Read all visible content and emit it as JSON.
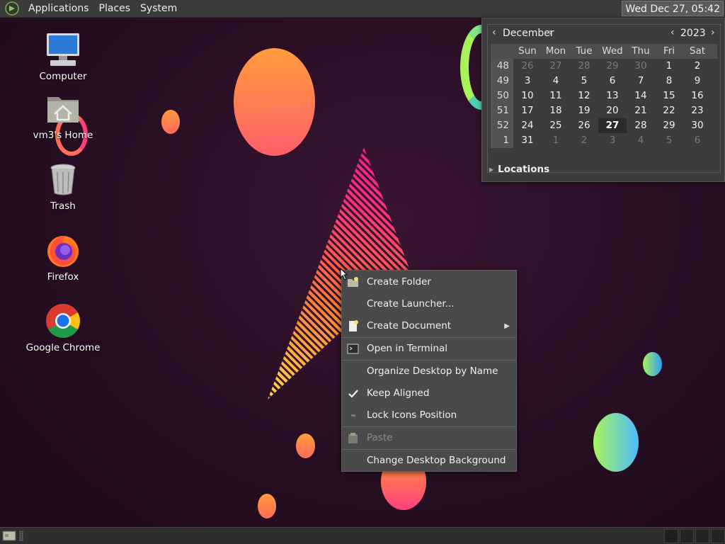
{
  "top_panel": {
    "menus": [
      "Applications",
      "Places",
      "System"
    ],
    "clock": "Wed Dec 27, 05:42"
  },
  "desktop_icons": [
    {
      "label": "Computer",
      "icon": "computer-icon"
    },
    {
      "label": "vm3's Home",
      "icon": "home-folder-icon"
    },
    {
      "label": "Trash",
      "icon": "trash-icon"
    },
    {
      "label": "Firefox",
      "icon": "firefox-icon"
    },
    {
      "label": "Google Chrome",
      "icon": "chrome-icon"
    }
  ],
  "calendar": {
    "month": "December",
    "year": "2023",
    "weekday_headers": [
      "Sun",
      "Mon",
      "Tue",
      "Wed",
      "Thu",
      "Fri",
      "Sat"
    ],
    "weeks": [
      {
        "week": "48",
        "days": [
          "26",
          "27",
          "28",
          "29",
          "30",
          "1",
          "2"
        ]
      },
      {
        "week": "49",
        "days": [
          "3",
          "4",
          "5",
          "6",
          "7",
          "8",
          "9"
        ]
      },
      {
        "week": "50",
        "days": [
          "10",
          "11",
          "12",
          "13",
          "14",
          "15",
          "16"
        ]
      },
      {
        "week": "51",
        "days": [
          "17",
          "18",
          "19",
          "20",
          "21",
          "22",
          "23"
        ]
      },
      {
        "week": "52",
        "days": [
          "24",
          "25",
          "26",
          "27",
          "28",
          "29",
          "30"
        ]
      },
      {
        "week": "1",
        "days": [
          "31",
          "1",
          "2",
          "3",
          "4",
          "5",
          "6"
        ]
      }
    ],
    "today": "27",
    "locations_label": "Locations"
  },
  "context_menu": {
    "items": [
      {
        "label": "Create Folder",
        "icon": "folder-new-icon",
        "enabled": true
      },
      {
        "label": "Create Launcher...",
        "icon": "",
        "enabled": true
      },
      {
        "label": "Create Document",
        "icon": "document-new-icon",
        "enabled": true,
        "submenu": true
      },
      {
        "label": "Open in Terminal",
        "icon": "terminal-icon",
        "enabled": true
      },
      {
        "label": "Organize Desktop by Name",
        "icon": "",
        "enabled": true
      },
      {
        "label": "Keep Aligned",
        "icon": "checkmark-icon",
        "enabled": true,
        "checked": true
      },
      {
        "label": "Lock Icons Position",
        "icon": "checkbox-unchecked-icon",
        "enabled": true
      },
      {
        "label": "Paste",
        "icon": "paste-icon",
        "enabled": false
      },
      {
        "label": "Change Desktop Background",
        "icon": "",
        "enabled": true
      }
    ]
  }
}
